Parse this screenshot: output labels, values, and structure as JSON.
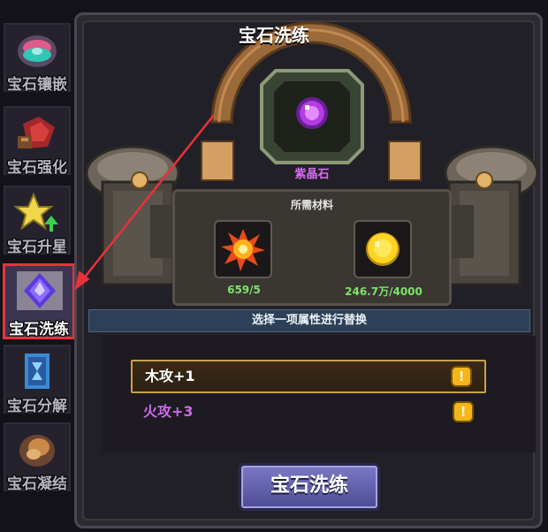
{
  "window": {
    "title": "宝石洗练"
  },
  "tabs": [
    {
      "label": "宝石镶嵌",
      "icon": "gem-inlay-icon"
    },
    {
      "label": "宝石强化",
      "icon": "gem-strengthen-icon"
    },
    {
      "label": "宝石升星",
      "icon": "gem-star-icon"
    },
    {
      "label": "宝石洗练",
      "icon": "gem-refine-icon",
      "active": true
    },
    {
      "label": "宝石分解",
      "icon": "gem-decompose-icon"
    },
    {
      "label": "宝石凝结",
      "icon": "gem-condense-icon"
    }
  ],
  "gem": {
    "name": "紫晶石",
    "icon": "amethyst-icon"
  },
  "materials": {
    "title": "所需材料",
    "items": [
      {
        "icon": "fire-essence-icon",
        "count": "659/5"
      },
      {
        "icon": "gold-coin-icon",
        "count": "246.7万/4000"
      }
    ]
  },
  "instruction": "选择一项属性进行替换",
  "attributes": [
    {
      "label": "木攻+1",
      "selected": true,
      "color": "#ffffff"
    },
    {
      "label": "火攻+3",
      "selected": false,
      "color": "#cc6aea"
    }
  ],
  "action_button": {
    "label": "宝石洗练"
  },
  "colors": {
    "highlight_border": "#e8323a",
    "arrow": "#e8323a",
    "button": "#6664b2"
  }
}
